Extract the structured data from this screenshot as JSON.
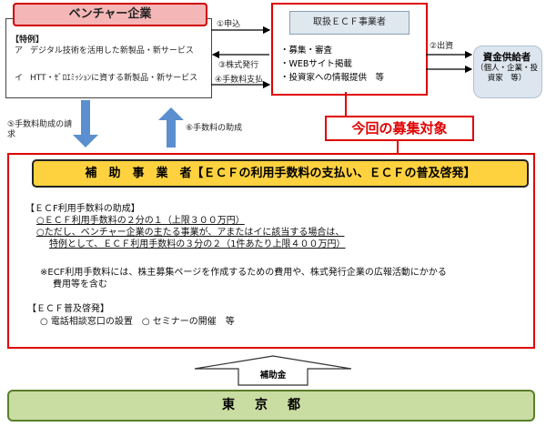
{
  "venture": {
    "title": "ベンチャー企業",
    "tokurei": "【特例】",
    "item_a_mark": "ア",
    "item_a_text": "デジタル技術を活用した新製品・新サービス",
    "item_i_mark": "イ",
    "item_i_text": "HTT・ｾﾞﾛｴﾐｯｼｮﾝに資する新製品・新サービス"
  },
  "ecf_operator": {
    "title": "取扱ＥＣＦ事業者",
    "items": [
      "・募集・審査",
      "・WEBサイト掲載",
      "・投資家への情報提供　等"
    ]
  },
  "funders": {
    "title": "資金供給者",
    "sub": "（個人・企業・投資家　等）"
  },
  "flows": {
    "f1": "①申込",
    "f2": "②出資",
    "f3": "③株式発行",
    "f4": "④手数料支払",
    "f5": "⑤手数料助成の請求",
    "f6": "⑥手数料の助成"
  },
  "callout": "今回の募集対象",
  "subsidy_operator": {
    "title": "補　助　事　業　者【ＥＣＦの利用手数料の支払い、ＥＣＦの普及啓発】",
    "s1_heading": "【ＥＣF利用手数料の助成】",
    "s1_l1": "○ＥＣＦ利用手数料の２分の１（上限３００万円）",
    "s1_l2": "○ただし、ベンチャー企業の主たる事業が、アまたはイに該当する場合は、",
    "s1_l3": "特例として、ＥＣＦ利用手数料の３分の２（1件あたり上限４００万円）",
    "s1_note1": "※ECF利用手数料には、株主募集ページを作成するための費用や、株式発行企業の広報活動にかかる",
    "s1_note2": "費用等を含む",
    "s2_heading": "【ＥＣＦ普及啓発】",
    "s2_items": "○ 電話相談窓口の設置　○ セミナーの開催　等"
  },
  "subsidy_label": "補助金",
  "tokyo": "東京都",
  "colors": {
    "red": "#e00000",
    "yellow": "#fed23f",
    "blue_arrow": "#5b8fcf",
    "green": "#c9dca2",
    "pink": "#f4b6b6"
  }
}
